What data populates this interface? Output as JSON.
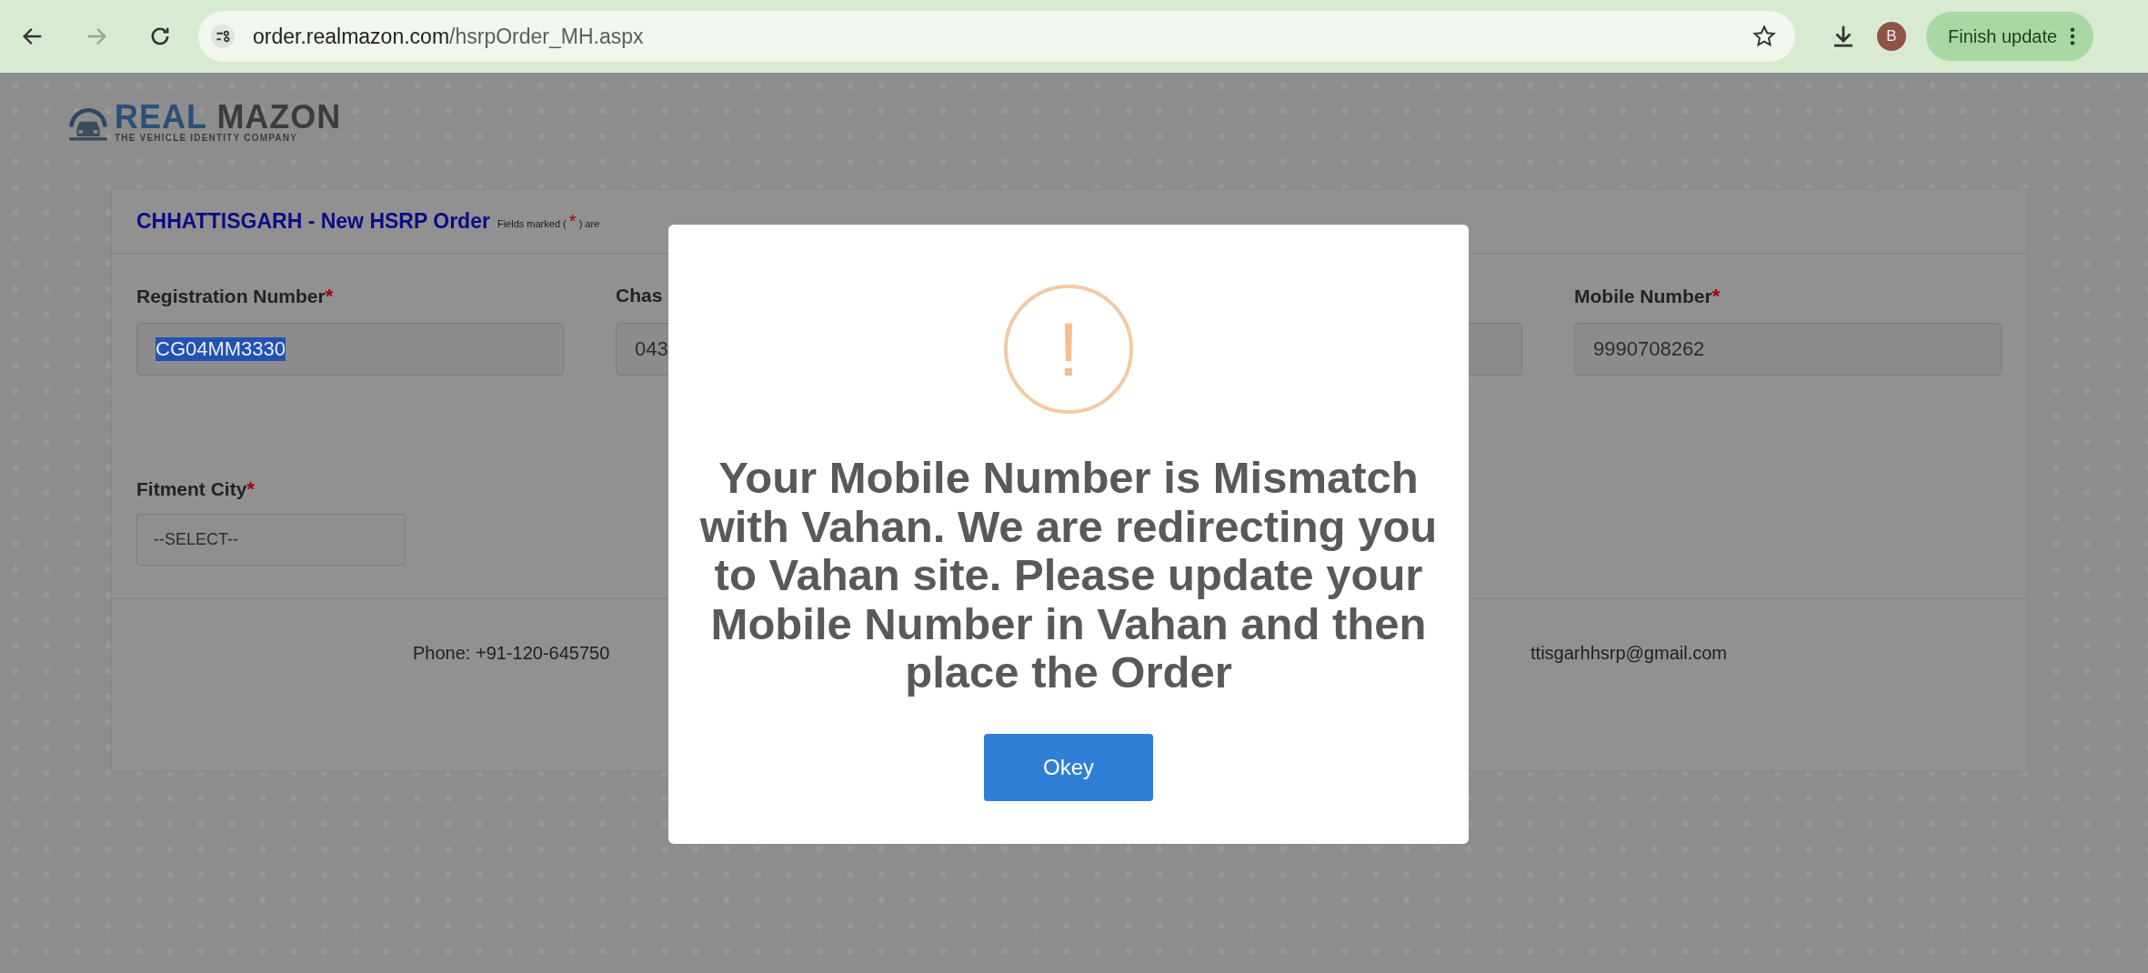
{
  "browser": {
    "url_host": "order.realmazon.com",
    "url_path": "/hsrpOrder_MH.aspx",
    "forward_disabled": true,
    "avatar_letter": "B",
    "update_button": "Finish update"
  },
  "logo": {
    "word_1": "REAL",
    "word_2": "MAZON",
    "tagline": "THE VEHICLE IDENTITY COMPANY"
  },
  "form": {
    "title": "CHHATTISGARH - New HSRP Order",
    "note_prefix": "Fields marked (",
    "note_mark": "*",
    "note_suffix": ") are",
    "fields": [
      {
        "kind": "field",
        "label": "Registration Number",
        "required_mark": "*",
        "value": "CG04MM3330",
        "text_selected": true
      },
      {
        "kind": "field",
        "label": "Chas",
        "value": "043",
        "text_selected": false
      },
      {
        "kind": "field"
      },
      {
        "kind": "field",
        "label": "Mobile Number",
        "required_mark": "*",
        "value": "9990708262",
        "text_selected": false
      }
    ],
    "city": {
      "kind": "select",
      "label": "Fitment City",
      "required_mark": "*",
      "value": "--SELECT--"
    },
    "footer": {
      "phone": "Phone: +91-120-645750",
      "email": "ttisgarhhsrp@gmail.com"
    }
  },
  "dialog": {
    "icon": "!",
    "message": "Your Mobile Number is Mismatch with Vahan. We are redirecting you to Vahan site. Please update your Mobile Number in Vahan and then place the Order",
    "button": "Okey"
  }
}
